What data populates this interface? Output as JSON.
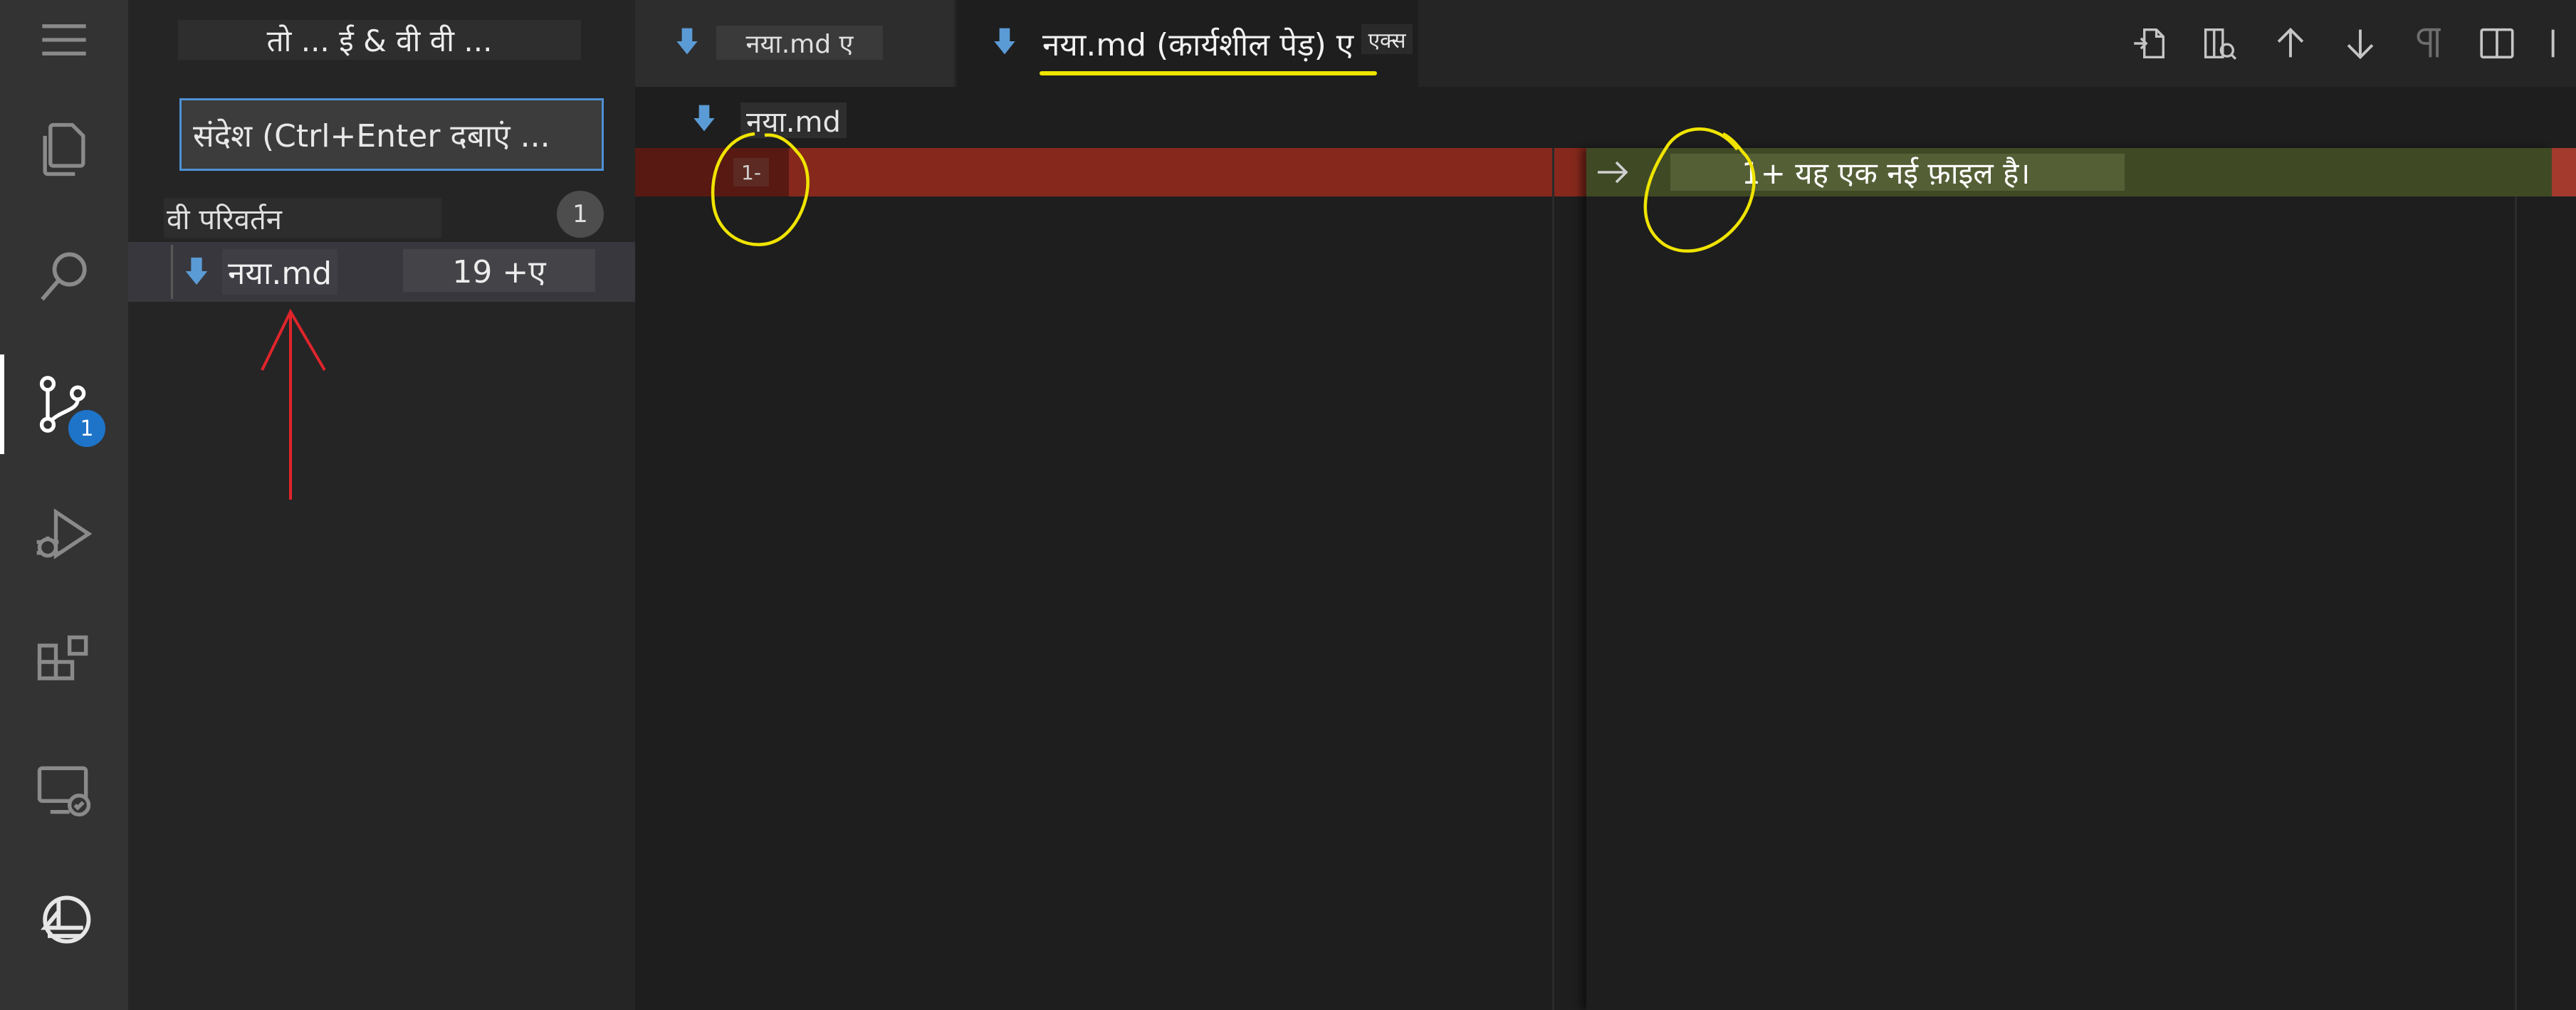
{
  "sidebar": {
    "title": "तो ... ई & वी वी ...",
    "commit_placeholder": "संदेश (Ctrl+Enter दबाएं ...",
    "changes_header": "वी परिवर्तन",
    "changes_count": "1",
    "files": [
      {
        "name": "नया.md",
        "stat": "19 +ए"
      }
    ]
  },
  "activity_bar": {
    "items": [
      "menu-icon",
      "explorer-icon",
      "search-icon",
      "source-control-icon",
      "run-debug-icon",
      "extensions-icon",
      "remote-explorer-icon",
      "account-icon"
    ],
    "source_control_badge": "1"
  },
  "tabs": [
    {
      "label": "नया.md ए"
    },
    {
      "label": "नया.md (कार्यशील पेड़) ए",
      "extra": "एक्स"
    }
  ],
  "breadcrumb": {
    "label": "नया.md"
  },
  "diff": {
    "left_line": "1-",
    "right_line": "1+ यह एक नई फ़ाइल है।"
  },
  "colors": {
    "deleted": "#86291c",
    "inserted": "#3f4a25",
    "accent": "#1e74c9",
    "annotation_yellow": "#f0e400",
    "annotation_red": "#e0252b"
  }
}
